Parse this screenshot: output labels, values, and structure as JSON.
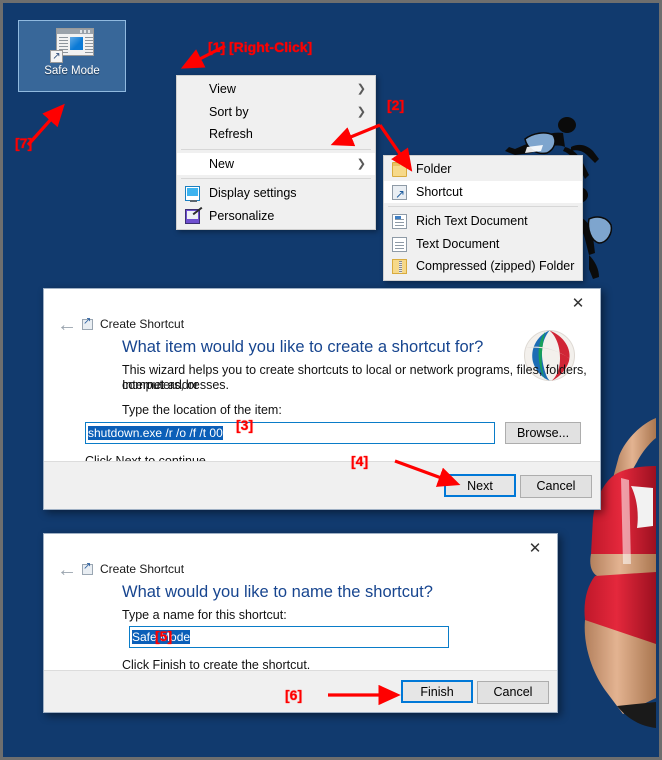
{
  "desktop": {
    "background_color": "#113a6e",
    "icon": {
      "label": "Safe Mode",
      "icon_name": "shortcut-window-icon"
    }
  },
  "context_menu": {
    "items": [
      {
        "label": "View",
        "submenu": true,
        "icon": null,
        "highlighted": false
      },
      {
        "label": "Sort by",
        "submenu": true,
        "icon": null,
        "highlighted": false
      },
      {
        "label": "Refresh",
        "submenu": false,
        "icon": null,
        "highlighted": false
      },
      {
        "separator": true
      },
      {
        "label": "New",
        "submenu": true,
        "icon": null,
        "highlighted": true
      },
      {
        "separator": true
      },
      {
        "label": "Display settings",
        "submenu": false,
        "icon": "monitor-icon",
        "highlighted": false
      },
      {
        "label": "Personalize",
        "submenu": false,
        "icon": "paintbrush-icon",
        "highlighted": false
      }
    ]
  },
  "submenu_new": {
    "items": [
      {
        "label": "Folder",
        "icon": "folder-icon",
        "highlighted": false
      },
      {
        "label": "Shortcut",
        "icon": "shortcut-icon",
        "highlighted": true
      },
      {
        "separator": true
      },
      {
        "label": "Rich Text Document",
        "icon": "rtf-icon",
        "highlighted": false
      },
      {
        "label": "Text Document",
        "icon": "text-icon",
        "highlighted": false
      },
      {
        "label": "Compressed (zipped) Folder",
        "icon": "zip-icon",
        "highlighted": false
      }
    ]
  },
  "dialog_1": {
    "app_title": "Create Shortcut",
    "heading": "What item would you like to create a shortcut for?",
    "body_line_1": "This wizard helps you to create shortcuts to local or network programs, files, folders, computers, or",
    "body_line_2": "Internet addresses.",
    "field_label": "Type the location of the item:",
    "field_value": "shutdown.exe /r /o /f /t 00",
    "browse_label": "Browse...",
    "hint": "Click Next to continue.",
    "next_label": "Next",
    "cancel_label": "Cancel",
    "close_label": "✕",
    "back_label": "←"
  },
  "dialog_2": {
    "app_title": "Create Shortcut",
    "heading": "What would you like to name the shortcut?",
    "field_label": "Type a name for this shortcut:",
    "field_value": "Safe Mode",
    "hint": "Click Finish to create the shortcut.",
    "finish_label": "Finish",
    "cancel_label": "Cancel",
    "close_label": "✕",
    "back_label": "←"
  },
  "annotations": {
    "color": "#ff0000",
    "step_1": "[1] [Right-Click]",
    "step_2": "[2]",
    "step_3": "[3]",
    "step_4": "[4]",
    "step_5": "[5]",
    "step_6": "[6]",
    "step_7": "[7]"
  }
}
